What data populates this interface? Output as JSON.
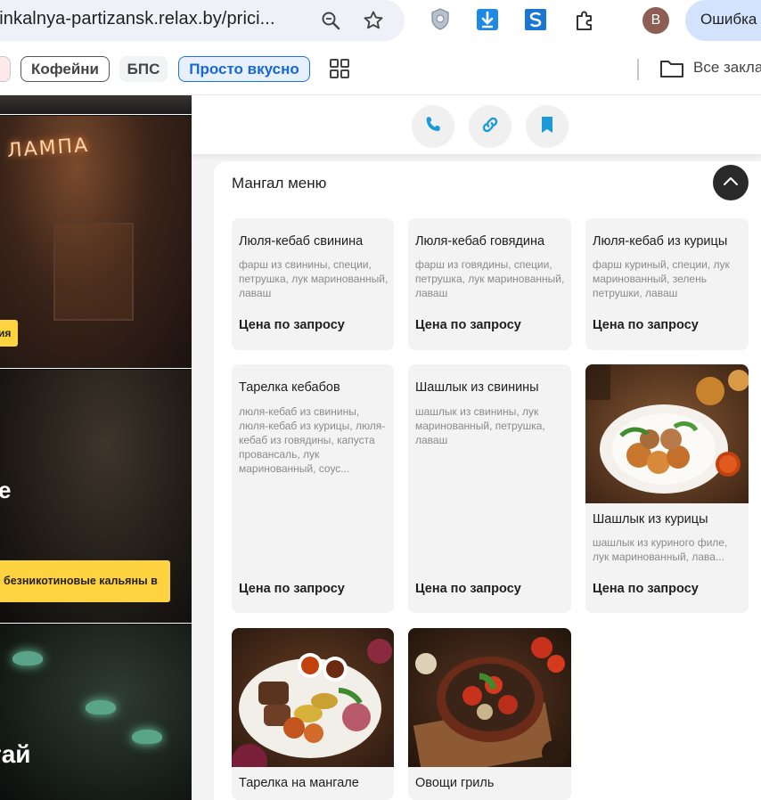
{
  "browser": {
    "url": "hinkalnya-partizansk.relax.by/prici...",
    "avatar_letter": "В",
    "error_label": "Ошибка",
    "icons": [
      "zoom-icon",
      "star-icon",
      "shield-extension-icon",
      "download-extension-icon",
      "s-extension-icon",
      "puzzle-extension-icon"
    ]
  },
  "bookmarks": {
    "items": [
      {
        "label": "Кофейни"
      },
      {
        "label": "БПС"
      },
      {
        "label": "Просто вкусно"
      }
    ],
    "all_bookmarks": "Все закла"
  },
  "left_column": {
    "photo1_sign": "ЛАМПА",
    "photo1_tag": "ия",
    "photo2_title": "е",
    "photo2_tag": "безникотиновые кальяны в",
    "photo3_title": "тай"
  },
  "actions": {
    "icons": [
      "phone-icon",
      "link-icon",
      "bookmark-icon"
    ],
    "accent": "#1a9bd7"
  },
  "menu": {
    "title": "Мангал меню",
    "items": [
      {
        "name": "Люля-кебаб свинина",
        "desc": "фарш из свинины, специи, петрушка, лук маринованный, лаваш",
        "price": "Цена по запросу"
      },
      {
        "name": "Люля-кебаб говядина",
        "desc": "фарш из говядины, специи, петрушка, лук маринованный, лаваш",
        "price": "Цена по запросу"
      },
      {
        "name": "Люля-кебаб из курицы",
        "desc": "фарш куриный, специи, лук маринованный, зелень петрушки, лаваш",
        "price": "Цена по запросу"
      },
      {
        "name": "Тарелка кебабов",
        "desc": "люля-кебаб из свинины, люля-кебаб из курицы, люля-кебаб из говядины, капуста провансаль, лук маринованный, соус...",
        "price": "Цена по запросу"
      },
      {
        "name": "Шашлык из свинины",
        "desc": "шашлык из свинины, лук маринованный, петрушка, лаваш",
        "price": "Цена по запросу"
      },
      {
        "name": "Шашлык из курицы",
        "desc": "шашлык из куриного филе, лук маринованный, лава...",
        "price": "Цена по запросу"
      },
      {
        "name": "Тарелка на мангале"
      },
      {
        "name": "Овощи гриль"
      }
    ]
  }
}
